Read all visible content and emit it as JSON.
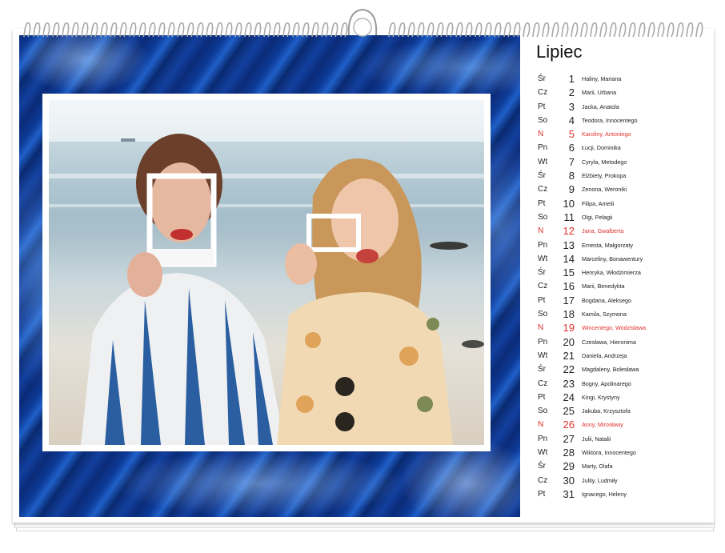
{
  "calendar": {
    "month": "Lipiec",
    "days": [
      {
        "dow": "Śr",
        "day": "1",
        "names": "Haliny, Mariana",
        "sunday": false
      },
      {
        "dow": "Cz",
        "day": "2",
        "names": "Marii, Urbana",
        "sunday": false
      },
      {
        "dow": "Pt",
        "day": "3",
        "names": "Jacka, Anatola",
        "sunday": false
      },
      {
        "dow": "So",
        "day": "4",
        "names": "Teodora, Innocentego",
        "sunday": false
      },
      {
        "dow": "N",
        "day": "5",
        "names": "Karoliny, Antoniego",
        "sunday": true
      },
      {
        "dow": "Pn",
        "day": "6",
        "names": "Łucji, Dominika",
        "sunday": false
      },
      {
        "dow": "Wt",
        "day": "7",
        "names": "Cyryla, Metodego",
        "sunday": false
      },
      {
        "dow": "Śr",
        "day": "8",
        "names": "Elżbiety, Prokopa",
        "sunday": false
      },
      {
        "dow": "Cz",
        "day": "9",
        "names": "Zenona, Weroniki",
        "sunday": false
      },
      {
        "dow": "Pt",
        "day": "10",
        "names": "Filipa, Amelii",
        "sunday": false
      },
      {
        "dow": "So",
        "day": "11",
        "names": "Olgi, Pelagii",
        "sunday": false
      },
      {
        "dow": "N",
        "day": "12",
        "names": "Jana, Gwalberta",
        "sunday": true
      },
      {
        "dow": "Pn",
        "day": "13",
        "names": "Ernesta, Małgorzaty",
        "sunday": false
      },
      {
        "dow": "Wt",
        "day": "14",
        "names": "Marceliny, Bonawentury",
        "sunday": false
      },
      {
        "dow": "Śr",
        "day": "15",
        "names": "Henryka, Włodzimierza",
        "sunday": false
      },
      {
        "dow": "Cz",
        "day": "16",
        "names": "Marii, Benedykta",
        "sunday": false
      },
      {
        "dow": "Pt",
        "day": "17",
        "names": "Bogdana, Aleksego",
        "sunday": false
      },
      {
        "dow": "So",
        "day": "18",
        "names": "Kamila, Szymona",
        "sunday": false
      },
      {
        "dow": "N",
        "day": "19",
        "names": "Wincentego, Wodzisława",
        "sunday": true
      },
      {
        "dow": "Pn",
        "day": "20",
        "names": "Czesława, Hieronima",
        "sunday": false
      },
      {
        "dow": "Wt",
        "day": "21",
        "names": "Daniela, Andrzeja",
        "sunday": false
      },
      {
        "dow": "Śr",
        "day": "22",
        "names": "Magdaleny, Bolesława",
        "sunday": false
      },
      {
        "dow": "Cz",
        "day": "23",
        "names": "Bogny, Apolinarego",
        "sunday": false
      },
      {
        "dow": "Pt",
        "day": "24",
        "names": "Kingi, Krystyny",
        "sunday": false
      },
      {
        "dow": "So",
        "day": "25",
        "names": "Jakuba, Krzysztofa",
        "sunday": false
      },
      {
        "dow": "N",
        "day": "26",
        "names": "Anny, Mirosławy",
        "sunday": true
      },
      {
        "dow": "Pn",
        "day": "27",
        "names": "Julii, Natalii",
        "sunday": false
      },
      {
        "dow": "Wt",
        "day": "28",
        "names": "Wiktora, Innocentego",
        "sunday": false
      },
      {
        "dow": "Śr",
        "day": "29",
        "names": "Marty, Olafa",
        "sunday": false
      },
      {
        "dow": "Cz",
        "day": "30",
        "names": "Julity, Ludmiły",
        "sunday": false
      },
      {
        "dow": "Pt",
        "day": "31",
        "names": "Ignacego, Heleny",
        "sunday": false
      }
    ]
  },
  "colors": {
    "sunday": "#e0322c",
    "background_blue": "#0d3a96",
    "text": "#222222"
  }
}
